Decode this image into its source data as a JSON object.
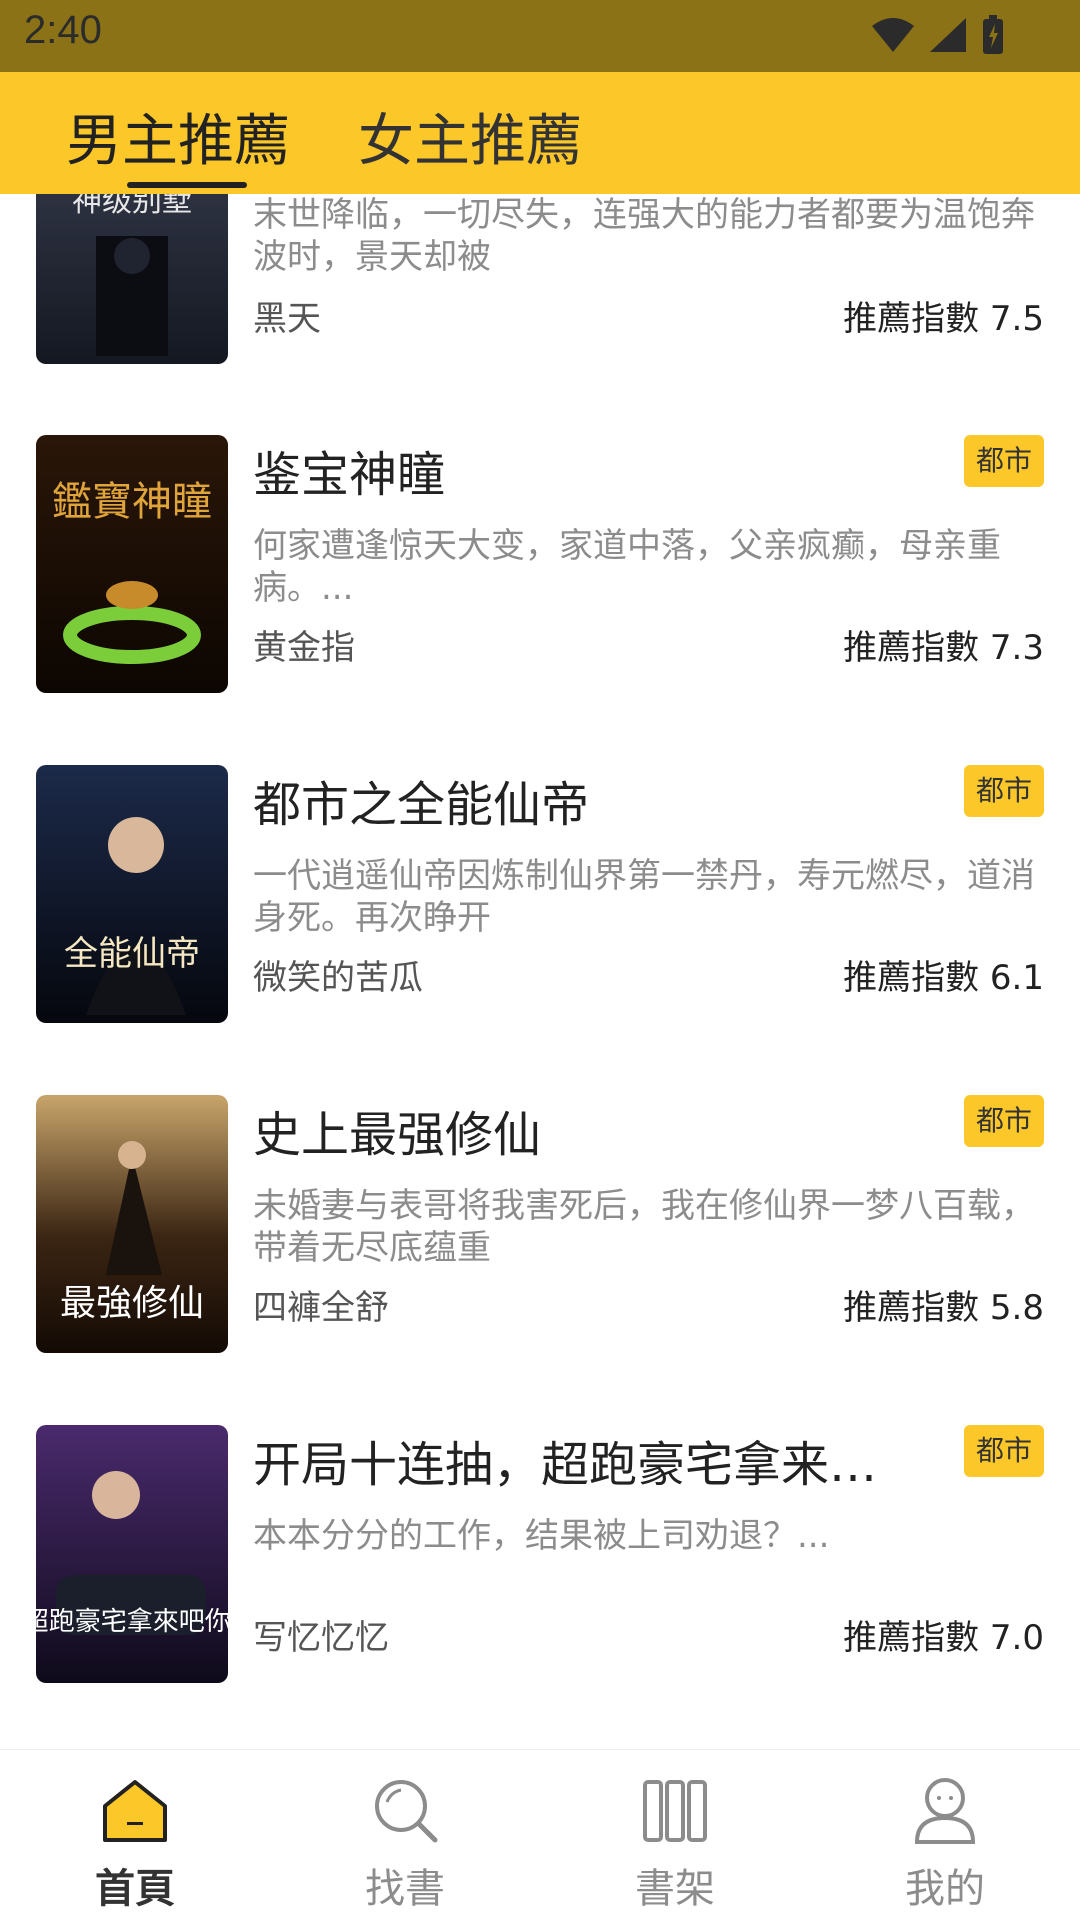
{
  "status_bar": {
    "time": "2:40"
  },
  "tabs": [
    {
      "label": "男主推薦",
      "active": true
    },
    {
      "label": "女主推薦",
      "active": false
    }
  ],
  "books": [
    {
      "title": "",
      "category": "",
      "cover_text": "神级别墅",
      "description": "末世降临，一切尽失，连强大的能力者都要为温饱奔波时，景天却被",
      "author": "黑天",
      "score_label": "推薦指數 7.5"
    },
    {
      "title": "鉴宝神瞳",
      "category": "都市",
      "cover_text": "鑑寶神瞳",
      "description": "何家遭逢惊天大变，家道中落，父亲疯癫，母亲重病。...",
      "author": "黄金指",
      "score_label": "推薦指數 7.3"
    },
    {
      "title": "都市之全能仙帝",
      "category": "都市",
      "cover_text": "全能仙帝",
      "description": "一代逍遥仙帝因炼制仙界第一禁丹，寿元燃尽，道消身死。再次睁开",
      "author": "微笑的苦瓜",
      "score_label": "推薦指數 6.1"
    },
    {
      "title": "史上最强修仙",
      "category": "都市",
      "cover_text": "最強修仙",
      "description": "未婚妻与表哥将我害死后，我在修仙界一梦八百载，带着无尽底蕴重",
      "author": "四褲全舒",
      "score_label": "推薦指數 5.8"
    },
    {
      "title": "开局十连抽，超跑豪宅拿来吧...",
      "category": "都市",
      "cover_text": "超跑豪宅拿來吧你!",
      "description": "本本分分的工作，结果被上司劝退？...",
      "author": "写忆忆忆",
      "score_label": "推薦指數 7.0"
    }
  ],
  "bottom_nav": [
    {
      "label": "首頁",
      "icon": "home-icon",
      "active": true
    },
    {
      "label": "找書",
      "icon": "search-icon",
      "active": false
    },
    {
      "label": "書架",
      "icon": "bookshelf-icon",
      "active": false
    },
    {
      "label": "我的",
      "icon": "profile-icon",
      "active": false
    }
  ],
  "colors": {
    "accent": "#fcc829",
    "status_bar": "#8b7216"
  }
}
